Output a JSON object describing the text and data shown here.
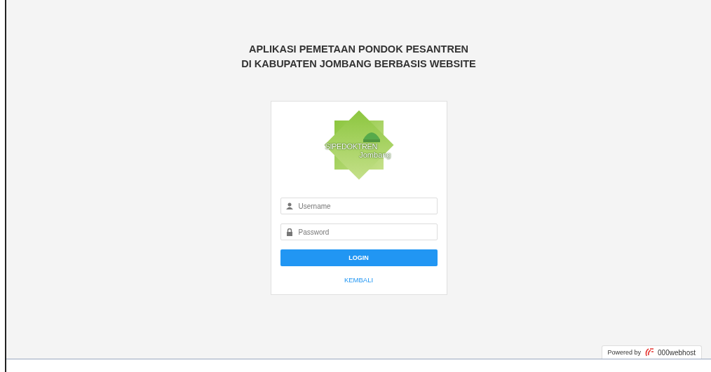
{
  "title": [
    "APLIKASI PEMETAAN PONDOK PESANTREN",
    "DI KABUPATEN JOMBANG BERBASIS WEBSITE"
  ],
  "logo": {
    "name": "SIPEDOKTREN",
    "subtitle": "Jombang"
  },
  "username": {
    "placeholder": "Username"
  },
  "password": {
    "placeholder": "Password"
  },
  "login_button": "LOGIN",
  "back_link": "KEMBALI",
  "badge": {
    "prefix": "Powered by",
    "brand": "000webhost"
  }
}
